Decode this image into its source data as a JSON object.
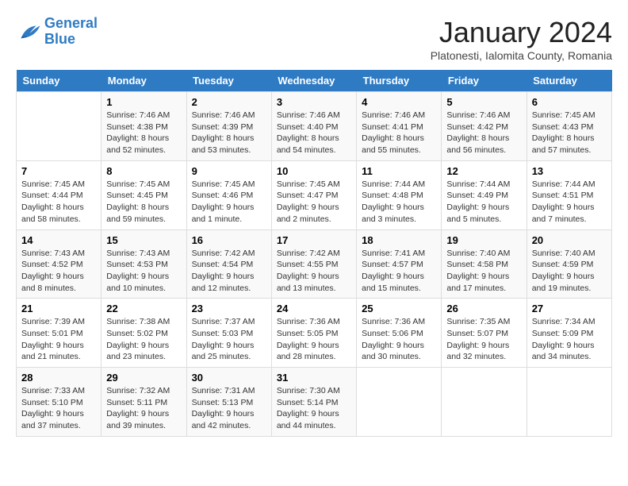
{
  "header": {
    "logo_line1": "General",
    "logo_line2": "Blue",
    "title": "January 2024",
    "subtitle": "Platonesti, Ialomita County, Romania"
  },
  "weekdays": [
    "Sunday",
    "Monday",
    "Tuesday",
    "Wednesday",
    "Thursday",
    "Friday",
    "Saturday"
  ],
  "weeks": [
    [
      {
        "day": "",
        "info": ""
      },
      {
        "day": "1",
        "info": "Sunrise: 7:46 AM\nSunset: 4:38 PM\nDaylight: 8 hours\nand 52 minutes."
      },
      {
        "day": "2",
        "info": "Sunrise: 7:46 AM\nSunset: 4:39 PM\nDaylight: 8 hours\nand 53 minutes."
      },
      {
        "day": "3",
        "info": "Sunrise: 7:46 AM\nSunset: 4:40 PM\nDaylight: 8 hours\nand 54 minutes."
      },
      {
        "day": "4",
        "info": "Sunrise: 7:46 AM\nSunset: 4:41 PM\nDaylight: 8 hours\nand 55 minutes."
      },
      {
        "day": "5",
        "info": "Sunrise: 7:46 AM\nSunset: 4:42 PM\nDaylight: 8 hours\nand 56 minutes."
      },
      {
        "day": "6",
        "info": "Sunrise: 7:45 AM\nSunset: 4:43 PM\nDaylight: 8 hours\nand 57 minutes."
      }
    ],
    [
      {
        "day": "7",
        "info": "Sunrise: 7:45 AM\nSunset: 4:44 PM\nDaylight: 8 hours\nand 58 minutes."
      },
      {
        "day": "8",
        "info": "Sunrise: 7:45 AM\nSunset: 4:45 PM\nDaylight: 8 hours\nand 59 minutes."
      },
      {
        "day": "9",
        "info": "Sunrise: 7:45 AM\nSunset: 4:46 PM\nDaylight: 9 hours\nand 1 minute."
      },
      {
        "day": "10",
        "info": "Sunrise: 7:45 AM\nSunset: 4:47 PM\nDaylight: 9 hours\nand 2 minutes."
      },
      {
        "day": "11",
        "info": "Sunrise: 7:44 AM\nSunset: 4:48 PM\nDaylight: 9 hours\nand 3 minutes."
      },
      {
        "day": "12",
        "info": "Sunrise: 7:44 AM\nSunset: 4:49 PM\nDaylight: 9 hours\nand 5 minutes."
      },
      {
        "day": "13",
        "info": "Sunrise: 7:44 AM\nSunset: 4:51 PM\nDaylight: 9 hours\nand 7 minutes."
      }
    ],
    [
      {
        "day": "14",
        "info": "Sunrise: 7:43 AM\nSunset: 4:52 PM\nDaylight: 9 hours\nand 8 minutes."
      },
      {
        "day": "15",
        "info": "Sunrise: 7:43 AM\nSunset: 4:53 PM\nDaylight: 9 hours\nand 10 minutes."
      },
      {
        "day": "16",
        "info": "Sunrise: 7:42 AM\nSunset: 4:54 PM\nDaylight: 9 hours\nand 12 minutes."
      },
      {
        "day": "17",
        "info": "Sunrise: 7:42 AM\nSunset: 4:55 PM\nDaylight: 9 hours\nand 13 minutes."
      },
      {
        "day": "18",
        "info": "Sunrise: 7:41 AM\nSunset: 4:57 PM\nDaylight: 9 hours\nand 15 minutes."
      },
      {
        "day": "19",
        "info": "Sunrise: 7:40 AM\nSunset: 4:58 PM\nDaylight: 9 hours\nand 17 minutes."
      },
      {
        "day": "20",
        "info": "Sunrise: 7:40 AM\nSunset: 4:59 PM\nDaylight: 9 hours\nand 19 minutes."
      }
    ],
    [
      {
        "day": "21",
        "info": "Sunrise: 7:39 AM\nSunset: 5:01 PM\nDaylight: 9 hours\nand 21 minutes."
      },
      {
        "day": "22",
        "info": "Sunrise: 7:38 AM\nSunset: 5:02 PM\nDaylight: 9 hours\nand 23 minutes."
      },
      {
        "day": "23",
        "info": "Sunrise: 7:37 AM\nSunset: 5:03 PM\nDaylight: 9 hours\nand 25 minutes."
      },
      {
        "day": "24",
        "info": "Sunrise: 7:36 AM\nSunset: 5:05 PM\nDaylight: 9 hours\nand 28 minutes."
      },
      {
        "day": "25",
        "info": "Sunrise: 7:36 AM\nSunset: 5:06 PM\nDaylight: 9 hours\nand 30 minutes."
      },
      {
        "day": "26",
        "info": "Sunrise: 7:35 AM\nSunset: 5:07 PM\nDaylight: 9 hours\nand 32 minutes."
      },
      {
        "day": "27",
        "info": "Sunrise: 7:34 AM\nSunset: 5:09 PM\nDaylight: 9 hours\nand 34 minutes."
      }
    ],
    [
      {
        "day": "28",
        "info": "Sunrise: 7:33 AM\nSunset: 5:10 PM\nDaylight: 9 hours\nand 37 minutes."
      },
      {
        "day": "29",
        "info": "Sunrise: 7:32 AM\nSunset: 5:11 PM\nDaylight: 9 hours\nand 39 minutes."
      },
      {
        "day": "30",
        "info": "Sunrise: 7:31 AM\nSunset: 5:13 PM\nDaylight: 9 hours\nand 42 minutes."
      },
      {
        "day": "31",
        "info": "Sunrise: 7:30 AM\nSunset: 5:14 PM\nDaylight: 9 hours\nand 44 minutes."
      },
      {
        "day": "",
        "info": ""
      },
      {
        "day": "",
        "info": ""
      },
      {
        "day": "",
        "info": ""
      }
    ]
  ]
}
